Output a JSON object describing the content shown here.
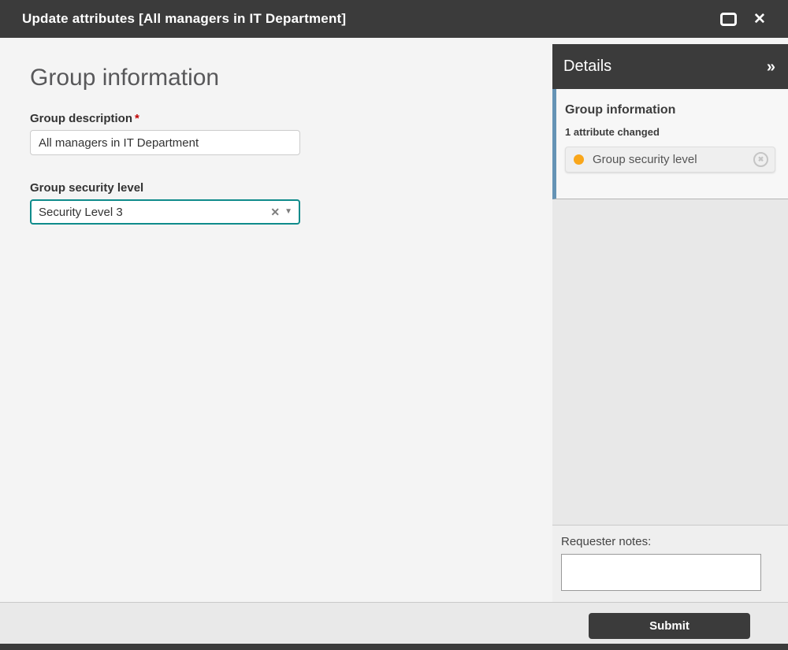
{
  "titlebar": {
    "title": "Update attributes [All managers in IT Department]"
  },
  "icons": {
    "close": "✕",
    "collapse_right": "»",
    "clear": "✕",
    "caret_down": "▼",
    "revert": "✖",
    "required_asterisk": "*"
  },
  "main": {
    "heading": "Group information",
    "fields": [
      {
        "label": "Group description",
        "required": true,
        "value": "All managers in IT Department"
      },
      {
        "label": "Group security level",
        "required": false,
        "value": "Security Level 3"
      }
    ]
  },
  "details_panel": {
    "header": "Details",
    "section": {
      "title": "Group information",
      "subtitle": "1 attribute changed",
      "changed_attribute": {
        "label": "Group security level",
        "status_color": "#f9a61a"
      }
    },
    "requester_notes": {
      "label": "Requester notes:",
      "value": ""
    }
  },
  "footer": {
    "submit_label": "Submit"
  },
  "colors": {
    "titlebar_bg": "#3b3b3b",
    "select_focus_border": "#0f8b8b",
    "section_accent_border": "#6593b5",
    "changed_dot": "#f9a61a",
    "required_red": "#c00000"
  }
}
